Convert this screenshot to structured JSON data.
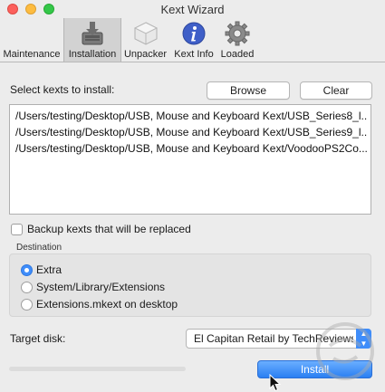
{
  "window": {
    "title": "Kext Wizard"
  },
  "toolbar": {
    "items": [
      {
        "label": "Maintenance",
        "icon": "maintenance-icon",
        "selected": false
      },
      {
        "label": "Installation",
        "icon": "installation-icon",
        "selected": true
      },
      {
        "label": "Unpacker",
        "icon": "unpacker-icon",
        "selected": false
      },
      {
        "label": "Kext Info",
        "icon": "info-icon",
        "selected": false
      },
      {
        "label": "Loaded",
        "icon": "gear-icon",
        "selected": false
      }
    ]
  },
  "install": {
    "select_label": "Select kexts to install:",
    "browse_label": "Browse",
    "clear_label": "Clear",
    "kexts": [
      "/Users/testing/Desktop/USB, Mouse and Keyboard Kext/USB_Series8_l...",
      "/Users/testing/Desktop/USB, Mouse and Keyboard Kext/USB_Series9_l...",
      "/Users/testing/Desktop/USB, Mouse and Keyboard Kext/VoodooPS2Co..."
    ],
    "backup_label": "Backup kexts that will be replaced",
    "backup_checked": false,
    "destination": {
      "title": "Destination",
      "options": [
        "Extra",
        "System/Library/Extensions",
        "Extensions.mkext on desktop"
      ],
      "selected": "Extra"
    },
    "target_label": "Target disk:",
    "target_value": "El Capitan Retail by TechReviews",
    "progress": 0,
    "install_label": "Install"
  },
  "colors": {
    "accent": "#3f8dfa",
    "close": "#fc605c",
    "minimize": "#fdbc40",
    "maximize": "#34c749"
  }
}
